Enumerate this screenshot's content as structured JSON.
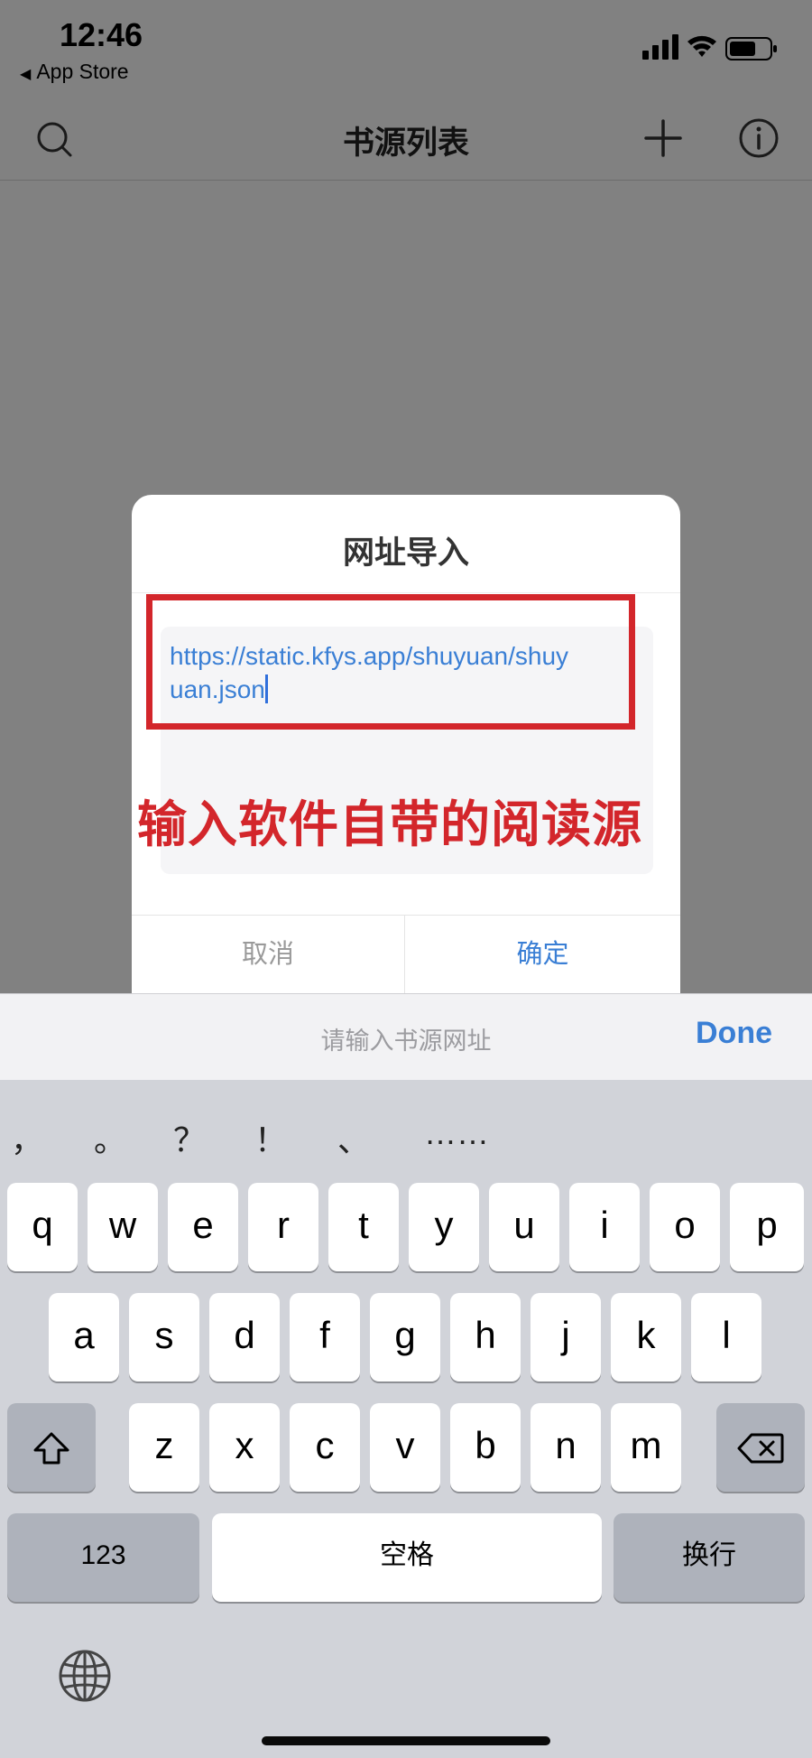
{
  "status_bar": {
    "time": "12:46",
    "back_label": "App Store"
  },
  "nav": {
    "title": "书源列表",
    "icons": [
      "search-icon",
      "plus-icon",
      "info-icon"
    ]
  },
  "dialog": {
    "title": "网址导入",
    "url_value": "https://static.kfys.app/shuyuan/shuyuan.json",
    "cancel_label": "取消",
    "confirm_label": "确定"
  },
  "annotation": {
    "text": "输入软件自带的阅读源",
    "color": "#d3262b"
  },
  "keyboard": {
    "placeholder": "请输入书源网址",
    "done_label": "Done",
    "punctuation": [
      "，",
      "。",
      "？",
      "！",
      "、",
      "……"
    ],
    "row1": [
      "q",
      "w",
      "e",
      "r",
      "t",
      "y",
      "u",
      "i",
      "o",
      "p"
    ],
    "row2": [
      "a",
      "s",
      "d",
      "f",
      "g",
      "h",
      "j",
      "k",
      "l"
    ],
    "row3": [
      "z",
      "x",
      "c",
      "v",
      "b",
      "n",
      "m"
    ],
    "numbers_label": "123",
    "space_label": "空格",
    "return_label": "换行"
  },
  "colors": {
    "accent": "#3a7fd5",
    "overlay": "rgba(0,0,0,0.48)"
  }
}
